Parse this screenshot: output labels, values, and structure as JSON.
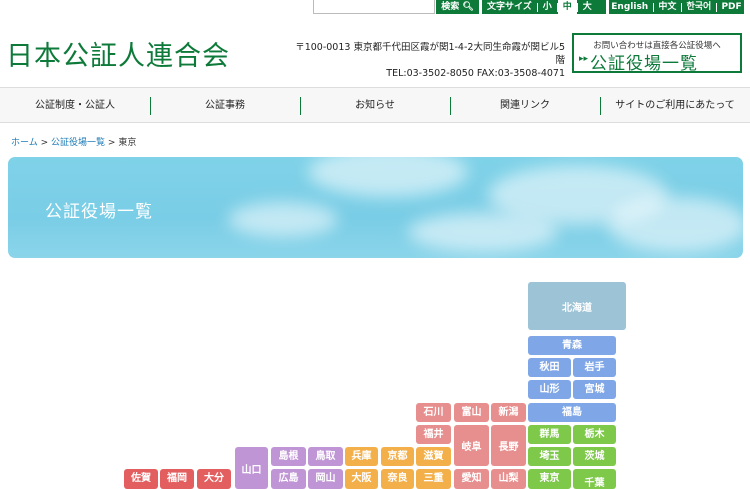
{
  "topbar": {
    "search_label": "検索",
    "fontsize_label": "文字サイズ",
    "sizes": [
      "小",
      "中",
      "大"
    ],
    "languages": [
      "English",
      "中文",
      "한국어",
      "PDF"
    ]
  },
  "header": {
    "logo": "日本公証人連合会",
    "address_line1": "〒100-0013 東京都千代田区霞が関1-4-2大同生命霞が関ビル5階",
    "address_line2": "TEL:03-3502-8050 FAX:03-3508-4071",
    "cta_small": "お問い合わせは直接各公証役場へ",
    "cta_big": "公証役場一覧"
  },
  "nav": {
    "items": [
      "公証制度・公証人",
      "公証事務",
      "お知らせ",
      "関連リンク",
      "サイトのご利用にあたって"
    ]
  },
  "breadcrumb": {
    "home": "ホーム",
    "list": "公証役場一覧",
    "current": "東京",
    "sep": ">"
  },
  "banner": {
    "title": "公証役場一覧"
  },
  "map": {
    "colors": {
      "hokkaido": "#9cc3d6",
      "tohoku": "#7fa6e6",
      "kanto": "#7ec84a",
      "chubu": "#e78e8e",
      "kinki": "#f3b04a",
      "chugoku": "#c095d5",
      "kyushu": "#e35f5f"
    },
    "prefs": {
      "hokkaido": "北海道",
      "aomori": "青森",
      "akita": "秋田",
      "iwate": "岩手",
      "yamagata": "山形",
      "miyagi": "宮城",
      "fukushima": "福島",
      "ishikawa": "石川",
      "toyama": "富山",
      "niigata": "新潟",
      "fukui": "福井",
      "gifu": "岐阜",
      "nagano": "長野",
      "gunma": "群馬",
      "tochigi": "栃木",
      "saitama": "埼玉",
      "ibaraki": "茨城",
      "tokyo": "東京",
      "chiba": "千葉",
      "shimane": "島根",
      "tottori": "鳥取",
      "hyogo": "兵庫",
      "kyoto": "京都",
      "shiga": "滋賀",
      "aichi": "愛知",
      "yamanashi": "山梨",
      "yamaguchi": "山口",
      "hiroshima": "広島",
      "okayama": "岡山",
      "osaka": "大阪",
      "nara": "奈良",
      "mie": "三重",
      "saga": "佐賀",
      "fukuoka": "福岡",
      "oita": "大分"
    }
  }
}
